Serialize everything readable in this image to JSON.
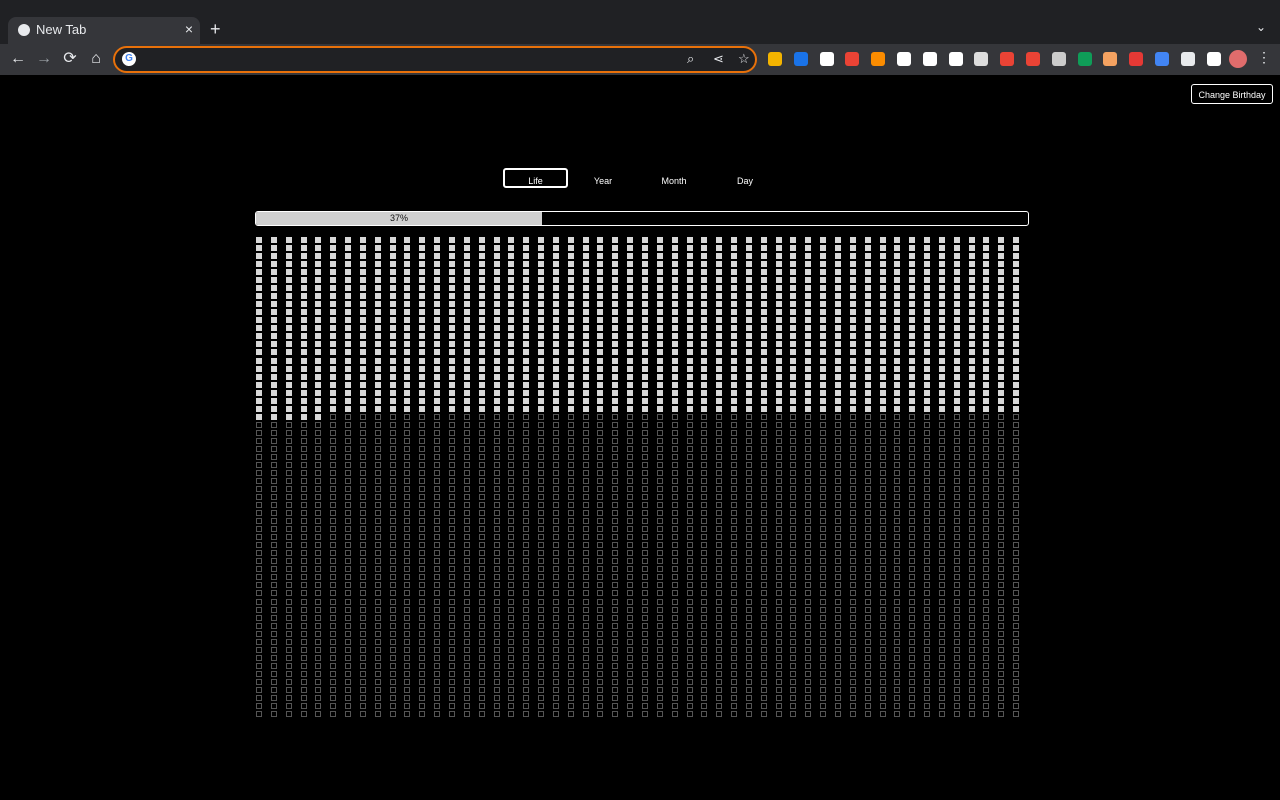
{
  "browser": {
    "tab_title": "New Tab",
    "tab_favicon": "globe-icon",
    "close_icon": "×",
    "new_tab_icon": "+",
    "omnibox_value": "",
    "extensions": [
      "#f4b400",
      "#1a73e8",
      "#ffffff",
      "#ea4335",
      "#fb8c00",
      "#ffffff",
      "#ffffff",
      "#ffffff",
      "#dddddd",
      "#ea4335",
      "#ea4335",
      "#cccccc",
      "#0f9d58",
      "#f4a261",
      "#e53935",
      "#4285f4",
      "#e8eaed",
      "#ffffff"
    ]
  },
  "page": {
    "change_birthday_label": "Change Birthday",
    "modes": [
      {
        "label": "Life",
        "active": true
      },
      {
        "label": "Year",
        "active": false
      },
      {
        "label": "Month",
        "active": false
      },
      {
        "label": "Day",
        "active": false
      }
    ],
    "progress_label": "37%",
    "progress_fraction": 0.37,
    "grid": {
      "columns": 52,
      "rows": 60,
      "filled_count": 1149
    }
  },
  "colors": {
    "accent_orange": "#e8710a",
    "filled_cell": "#d8d8d8",
    "empty_cell_border": "#555555"
  }
}
